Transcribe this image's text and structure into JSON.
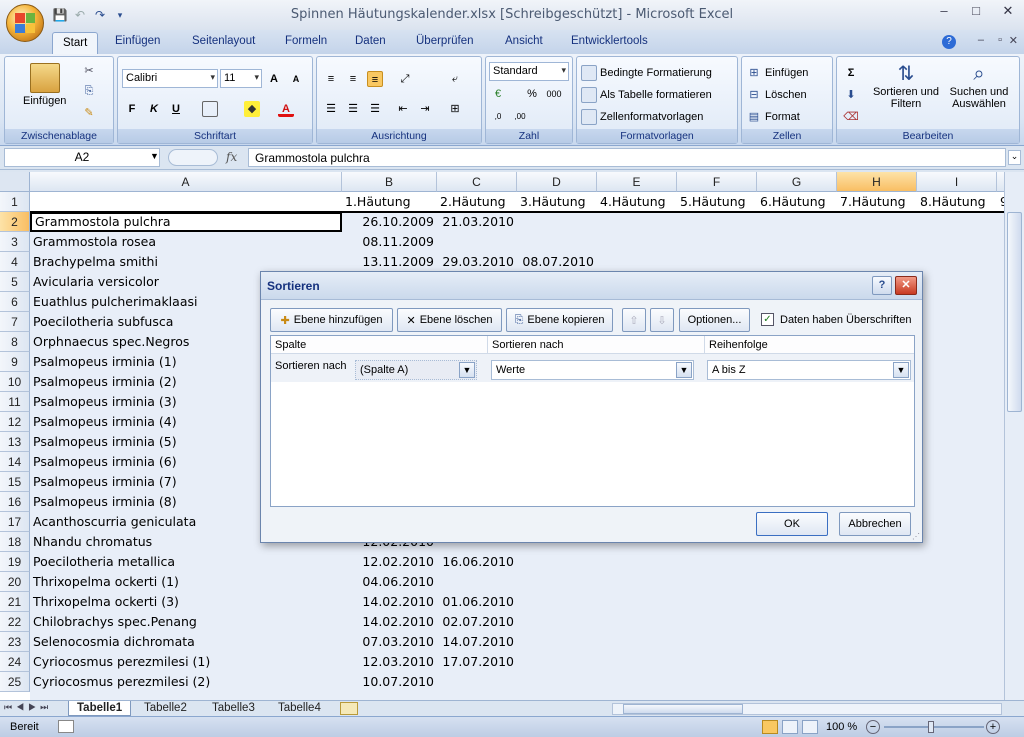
{
  "window": {
    "title": "Spinnen Häutungskalender.xlsx  [Schreibgeschützt] - Microsoft Excel"
  },
  "tabs": [
    "Start",
    "Einfügen",
    "Seitenlayout",
    "Formeln",
    "Daten",
    "Überprüfen",
    "Ansicht",
    "Entwicklertools"
  ],
  "ribbon": {
    "groups": {
      "clipboard": "Zwischenablage",
      "font": "Schriftart",
      "alignment": "Ausrichtung",
      "number": "Zahl",
      "styles": "Formatvorlagen",
      "cells": "Zellen",
      "editing": "Bearbeiten"
    },
    "paste": "Einfügen",
    "font_name": "Calibri",
    "font_size": "11",
    "number_format": "Standard",
    "cond_format": "Bedingte Formatierung",
    "as_table": "Als Tabelle formatieren",
    "cell_styles": "Zellenformatvorlagen",
    "insert": "Einfügen",
    "delete": "Löschen",
    "format": "Format",
    "sort_filter": "Sortieren und Filtern",
    "find_select": "Suchen und Auswählen"
  },
  "formula_bar": {
    "name_box": "A2",
    "fx": "fx",
    "content": "Grammostola pulchra"
  },
  "columns": [
    {
      "label": "A",
      "header": ""
    },
    {
      "label": "B",
      "header": "1.Häutung"
    },
    {
      "label": "C",
      "header": "2.Häutung"
    },
    {
      "label": "D",
      "header": "3.Häutung"
    },
    {
      "label": "E",
      "header": "4.Häutung"
    },
    {
      "label": "F",
      "header": "5.Häutung"
    },
    {
      "label": "G",
      "header": "6.Häutung"
    },
    {
      "label": "H",
      "header": "7.Häutung"
    },
    {
      "label": "I",
      "header": "8.Häutung"
    },
    {
      "label": "J",
      "header": "9"
    }
  ],
  "rows": [
    {
      "n": "1",
      "a": "",
      "b": "",
      "c": "",
      "d": ""
    },
    {
      "n": "2",
      "a": "Grammostola pulchra",
      "b": "26.10.2009",
      "c": "21.03.2010",
      "d": ""
    },
    {
      "n": "3",
      "a": "Grammostola rosea",
      "b": "08.11.2009",
      "c": "",
      "d": ""
    },
    {
      "n": "4",
      "a": "Brachypelma smithi",
      "b": "13.11.2009",
      "c": "29.03.2010",
      "d": "08.07.2010"
    },
    {
      "n": "5",
      "a": "Avicularia versicolor",
      "b": "",
      "c": "",
      "d": ""
    },
    {
      "n": "6",
      "a": "Euathlus pulcherimaklaasi",
      "b": "",
      "c": "",
      "d": ""
    },
    {
      "n": "7",
      "a": "Poecilotheria subfusca",
      "b": "",
      "c": "",
      "d": ""
    },
    {
      "n": "8",
      "a": "Orphnaecus spec.Negros",
      "b": "",
      "c": "",
      "d": ""
    },
    {
      "n": "9",
      "a": "Psalmopeus irminia (1)",
      "b": "",
      "c": "",
      "d": ""
    },
    {
      "n": "10",
      "a": "Psalmopeus irminia (2)",
      "b": "",
      "c": "",
      "d": ""
    },
    {
      "n": "11",
      "a": "Psalmopeus irminia (3)",
      "b": "",
      "c": "",
      "d": ""
    },
    {
      "n": "12",
      "a": "Psalmopeus irminia (4)",
      "b": "",
      "c": "",
      "d": ""
    },
    {
      "n": "13",
      "a": "Psalmopeus irminia (5)",
      "b": "",
      "c": "",
      "d": ""
    },
    {
      "n": "14",
      "a": "Psalmopeus irminia (6)",
      "b": "",
      "c": "",
      "d": ""
    },
    {
      "n": "15",
      "a": "Psalmopeus irminia (7)",
      "b": "",
      "c": "",
      "d": ""
    },
    {
      "n": "16",
      "a": "Psalmopeus irminia (8)",
      "b": "",
      "c": "",
      "d": ""
    },
    {
      "n": "17",
      "a": "Acanthoscurria geniculata",
      "b": "",
      "c": "",
      "d": ""
    },
    {
      "n": "18",
      "a": "Nhandu chromatus",
      "b": "12.02.2010",
      "c": "",
      "d": ""
    },
    {
      "n": "19",
      "a": "Poecilotheria metallica",
      "b": "12.02.2010",
      "c": "16.06.2010",
      "d": ""
    },
    {
      "n": "20",
      "a": "Thrixopelma ockerti (1)",
      "b": "04.06.2010",
      "c": "",
      "d": ""
    },
    {
      "n": "21",
      "a": "Thrixopelma ockerti (3)",
      "b": "14.02.2010",
      "c": "01.06.2010",
      "d": ""
    },
    {
      "n": "22",
      "a": "Chilobrachys spec.Penang",
      "b": "14.02.2010",
      "c": "02.07.2010",
      "d": ""
    },
    {
      "n": "23",
      "a": "Selenocosmia dichromata",
      "b": "07.03.2010",
      "c": "14.07.2010",
      "d": ""
    },
    {
      "n": "24",
      "a": "Cyriocosmus perezmilesi (1)",
      "b": "12.03.2010",
      "c": "17.07.2010",
      "d": ""
    },
    {
      "n": "25",
      "a": "Cyriocosmus perezmilesi (2)",
      "b": "10.07.2010",
      "c": "",
      "d": ""
    }
  ],
  "sheet_tabs": [
    "Tabelle1",
    "Tabelle2",
    "Tabelle3",
    "Tabelle4"
  ],
  "status": {
    "ready": "Bereit",
    "zoom": "100 %"
  },
  "dialog": {
    "title": "Sortieren",
    "add_level": "Ebene hinzufügen",
    "delete_level": "Ebene löschen",
    "copy_level": "Ebene kopieren",
    "options": "Optionen...",
    "has_headers": "Daten haben Überschriften",
    "has_headers_checked": true,
    "col_header": "Spalte",
    "sort_on_header": "Sortieren nach",
    "order_header": "Reihenfolge",
    "row_label": "Sortieren nach",
    "column_value": "(Spalte A)",
    "sort_on_value": "Werte",
    "order_value": "A bis Z",
    "ok": "OK",
    "cancel": "Abbrechen"
  }
}
